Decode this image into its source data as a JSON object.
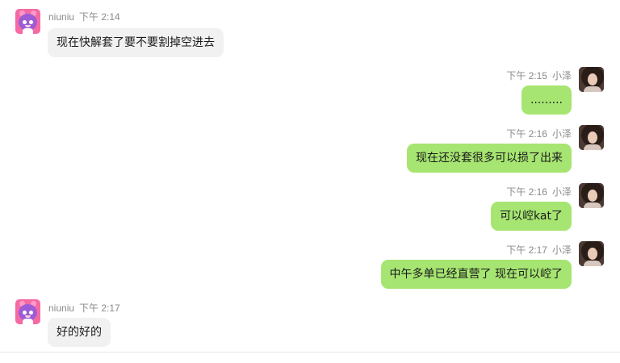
{
  "messages": [
    {
      "sender": "niuniu",
      "time": "下午 2:14",
      "text": "现在快解套了要不要割掉空进去"
    },
    {
      "sender": "小泽",
      "time": "下午 2:15",
      "text": "........."
    },
    {
      "sender": "小泽",
      "time": "下午 2:16",
      "text": "现在还没套很多可以损了出来"
    },
    {
      "sender": "小泽",
      "time": "下午 2:16",
      "text": "可以崆kat了"
    },
    {
      "sender": "小泽",
      "time": "下午 2:17",
      "text": "中午多单已经直营了 现在可以崆了"
    },
    {
      "sender": "niuniu",
      "time": "下午 2:17",
      "text": "好的好的"
    }
  ],
  "colors": {
    "incoming_bubble": "#f1f1f2",
    "outgoing_bubble": "#a6e571",
    "meta_text": "#8a8a8a"
  }
}
